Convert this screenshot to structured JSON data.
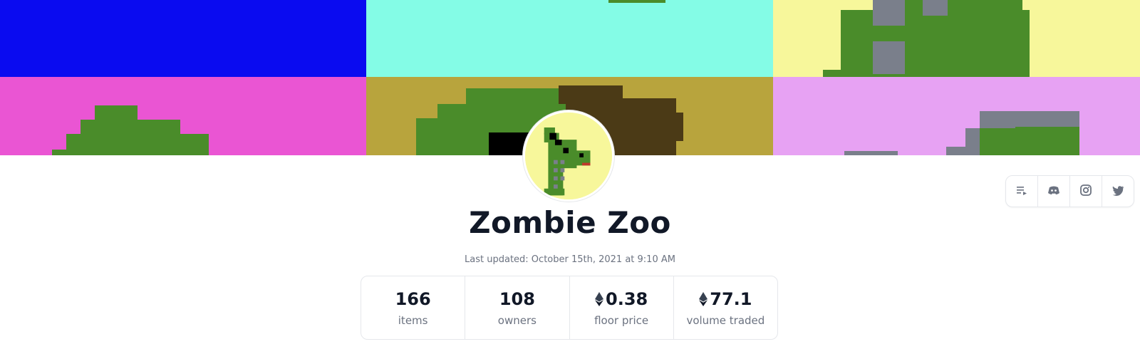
{
  "collection": {
    "name": "Zombie Zoo",
    "last_updated": "Last updated: October 15th, 2021 at 9:10 AM"
  },
  "stats": [
    {
      "value": "166",
      "label": "items",
      "currency_icon": ""
    },
    {
      "value": "108",
      "label": "owners",
      "currency_icon": ""
    },
    {
      "value": "0.38",
      "label": "floor price",
      "currency_icon": "ethereum-icon"
    },
    {
      "value": "77.1",
      "label": "volume traded",
      "currency_icon": "ethereum-icon"
    }
  ],
  "social_links": [
    {
      "icon": "website-list-icon"
    },
    {
      "icon": "discord-icon"
    },
    {
      "icon": "instagram-icon"
    },
    {
      "icon": "twitter-icon"
    }
  ],
  "colors": {
    "banner_blue": "#0a0bf0",
    "banner_aqua": "#84fce6",
    "banner_yellow": "#f7f79b",
    "banner_pink": "#ea55d3",
    "banner_mustard": "#b8a43d",
    "banner_lavender": "#e7a2f3",
    "zombie_green": "#4a8c2a",
    "zombie_gray": "#7a7f8b",
    "text_primary": "#111827",
    "text_secondary": "#6b7280"
  }
}
